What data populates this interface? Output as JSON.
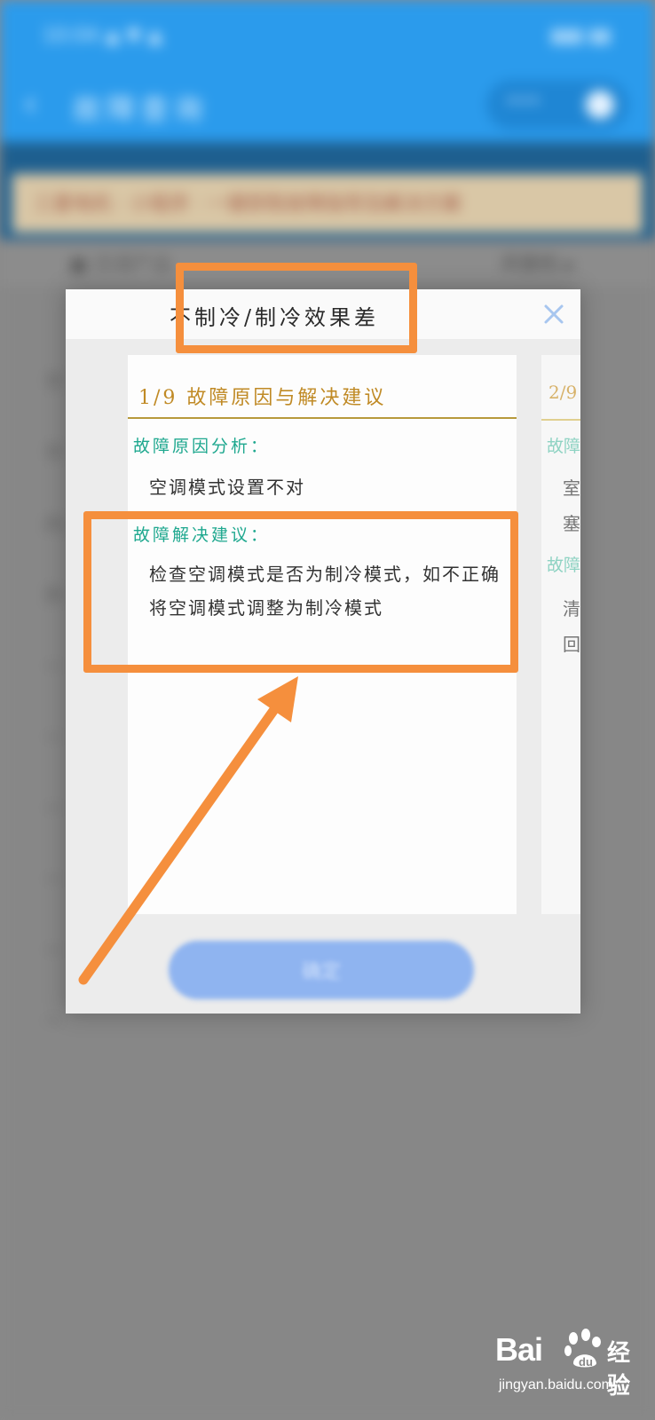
{
  "background": {
    "status_time": "10:04 ▲ ▼ ▲",
    "status_right": "▮▮▮ ▮▮",
    "header_title": "故障查询",
    "notice_text": "三菱电机 · 小程序 · 一键获取故障指导及解决方案",
    "product_left": "■ 空调产品",
    "product_right": "风管机 ▸",
    "side_chars": [
      "不",
      "不",
      "内",
      "外",
      "ㅡ",
      "ㅡ",
      "ㅡ",
      "ㅡ",
      "ㅡ",
      "ㅡ"
    ]
  },
  "modal": {
    "title": "不制冷/制冷效果差",
    "card1": {
      "header": "1/9 故障原因与解决建议",
      "cause_label": "故障原因分析：",
      "cause_text": "空调模式设置不对",
      "suggestion_label": "故障解决建议：",
      "suggestion_text": "检查空调模式是否为制冷模式，如不正确将空调模式调整为制冷模式"
    },
    "card2": {
      "header": "2/9",
      "cause_label": "故障",
      "line1": "室",
      "line2": "塞",
      "suggestion_label": "故障",
      "line3": "清",
      "line4": "回"
    },
    "confirm_label": "确定"
  },
  "watermark": {
    "brand": "Bai",
    "brand_cn": "经验",
    "url": "jingyan.baidu.com"
  },
  "colors": {
    "accent_orange": "#f58f3d",
    "header_blue": "#2b9bec",
    "label_green": "#1fa88f",
    "card_header_gold": "#c08a25"
  }
}
